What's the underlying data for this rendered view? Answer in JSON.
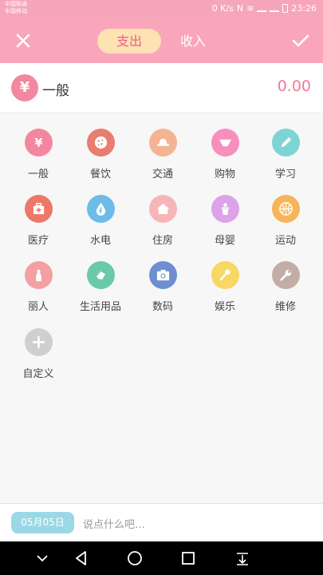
{
  "status": {
    "carrier1": "中国联通",
    "carrier2": "中国移动",
    "speed": "0 K/s",
    "time": "23:26"
  },
  "header": {
    "tab_expense": "支出",
    "tab_income": "收入"
  },
  "amount_row": {
    "category": "一般",
    "currency_symbol": "¥",
    "amount": "0.00"
  },
  "categories": [
    {
      "label": "一般",
      "color": "#f487a0",
      "icon": "yen-icon"
    },
    {
      "label": "餐饮",
      "color": "#e87d70",
      "icon": "cookie-icon"
    },
    {
      "label": "交通",
      "color": "#f4b493",
      "icon": "hat-icon"
    },
    {
      "label": "购物",
      "color": "#f68fbd",
      "icon": "underwear-icon"
    },
    {
      "label": "学习",
      "color": "#7dd4d5",
      "icon": "pencil-icon"
    },
    {
      "label": "医疗",
      "color": "#ec7867",
      "icon": "medical-kit-icon"
    },
    {
      "label": "水电",
      "color": "#6dbbe8",
      "icon": "water-drop-icon"
    },
    {
      "label": "住房",
      "color": "#f6b6b8",
      "icon": "house-icon"
    },
    {
      "label": "母婴",
      "color": "#dca3e9",
      "icon": "baby-bottle-icon"
    },
    {
      "label": "运动",
      "color": "#f7b459",
      "icon": "basketball-icon"
    },
    {
      "label": "丽人",
      "color": "#f4a0a3",
      "icon": "lipstick-icon"
    },
    {
      "label": "生活用品",
      "color": "#6ac9a8",
      "icon": "daily-goods-icon"
    },
    {
      "label": "数码",
      "color": "#6d8fd1",
      "icon": "camera-icon"
    },
    {
      "label": "娱乐",
      "color": "#f7d865",
      "icon": "microphone-icon"
    },
    {
      "label": "维修",
      "color": "#c2aea6",
      "icon": "wrench-icon"
    },
    {
      "label": "自定义",
      "color": "#cfcfcf",
      "icon": "plus-icon"
    }
  ],
  "bottom": {
    "date": "05月05日",
    "note_placeholder": "说点什么吧…"
  }
}
